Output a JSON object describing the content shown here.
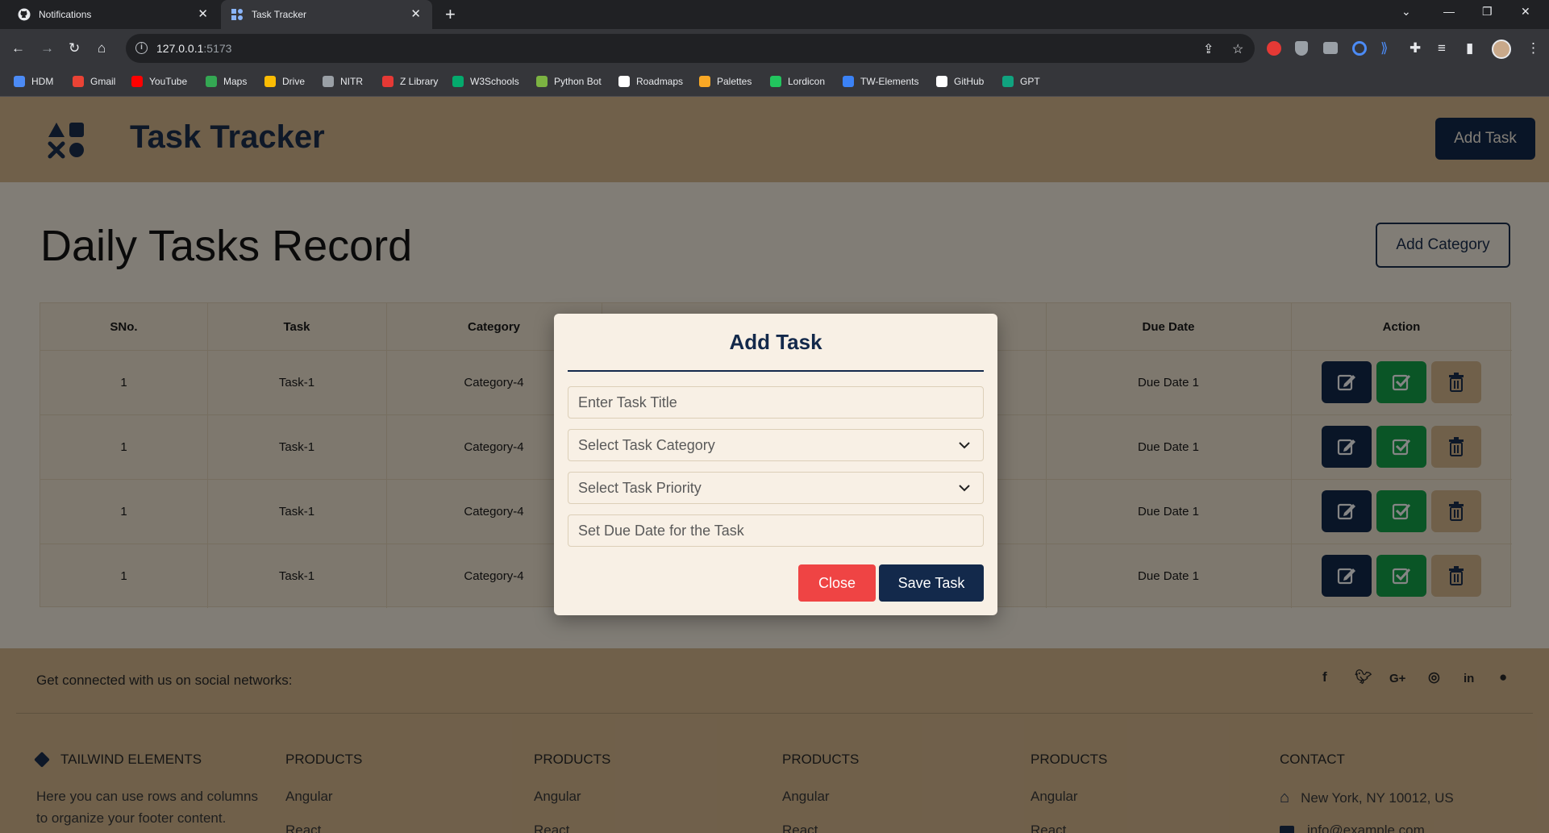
{
  "browser": {
    "tabs": [
      {
        "title": "Notifications",
        "icon": "github-icon"
      },
      {
        "title": "Task Tracker",
        "icon": "app-icon"
      }
    ],
    "url_host": "127.0.0.1",
    "url_port": ":5173",
    "bookmarks": [
      {
        "label": "HDM",
        "color": "#4c8bf5"
      },
      {
        "label": "Gmail",
        "color": "#ea4335"
      },
      {
        "label": "YouTube",
        "color": "#ff0000"
      },
      {
        "label": "Maps",
        "color": "#34a853"
      },
      {
        "label": "Drive",
        "color": "#fbbc04"
      },
      {
        "label": "NITR",
        "color": "#9aa0a6"
      },
      {
        "label": "Z Library",
        "color": "#e53935"
      },
      {
        "label": "W3Schools",
        "color": "#04aa6d"
      },
      {
        "label": "Python Bot",
        "color": "#7cb342"
      },
      {
        "label": "Roadmaps",
        "color": "#ffffff"
      },
      {
        "label": "Palettes",
        "color": "#f9a825"
      },
      {
        "label": "Lordicon",
        "color": "#22c55e"
      },
      {
        "label": "TW-Elements",
        "color": "#3b82f6"
      },
      {
        "label": "GitHub",
        "color": "#ffffff"
      },
      {
        "label": "GPT",
        "color": "#10a37f"
      }
    ]
  },
  "header": {
    "brand": "Task Tracker",
    "add_task_label": "Add Task"
  },
  "main": {
    "title": "Daily Tasks Record",
    "add_category_label": "Add Category",
    "columns": [
      "SNo.",
      "Task",
      "Category",
      "Due Date",
      "Action"
    ],
    "rows": [
      {
        "sno": "1",
        "task": "Task-1",
        "category": "Category-4",
        "due": "Due Date 1"
      },
      {
        "sno": "1",
        "task": "Task-1",
        "category": "Category-4",
        "due": "Due Date 1"
      },
      {
        "sno": "1",
        "task": "Task-1",
        "category": "Category-4",
        "due": "Due Date 1"
      },
      {
        "sno": "1",
        "task": "Task-1",
        "category": "Category-4",
        "due": "Due Date 1"
      }
    ]
  },
  "modal": {
    "title": "Add Task",
    "title_placeholder": "Enter Task Title",
    "category_placeholder": "Select Task Category",
    "priority_placeholder": "Select Task Priority",
    "due_placeholder": "Set Due Date for the Task",
    "close_label": "Close",
    "save_label": "Save Task"
  },
  "footer": {
    "social_text": "Get connected with us on social networks:",
    "social_icons": [
      "facebook-icon",
      "twitter-icon",
      "google-plus-icon",
      "instagram-icon",
      "linkedin-icon",
      "github-icon"
    ],
    "brand_heading": "TAILWIND ELEMENTS",
    "brand_text_1": "Here you can use rows and columns",
    "brand_text_2": "to organize your footer content.",
    "products_heading": "PRODUCTS",
    "product_1": "Angular",
    "product_2": "React",
    "contact_heading": "CONTACT",
    "contact_address": "New York, NY 10012, US",
    "contact_email": "info@example.com"
  },
  "colors": {
    "header_bg": "#d7b98f",
    "page_bg": "#f7efe3",
    "primary": "#13294b",
    "success": "#15a34a",
    "danger": "#ef4444"
  }
}
